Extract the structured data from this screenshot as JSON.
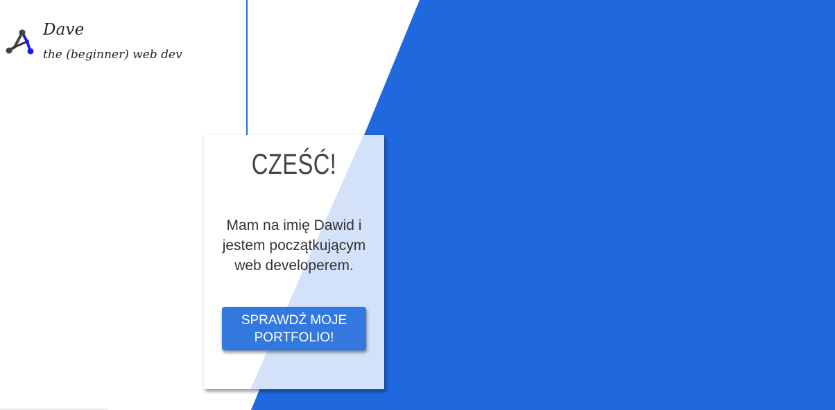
{
  "brand": {
    "name": "Dave",
    "tagline": "the (beginner) web dev",
    "logo_icon": "molecule-network-icon"
  },
  "hero": {
    "title": "CZEŚĆ!",
    "intro": "Mam na imię Dawid i jestem początkującym web developerem.",
    "cta_label": "SPRAWDŹ MOJE PORTFOLIO!"
  },
  "colors": {
    "accent_blue": "#1f68dd",
    "card_overlay": "#d3e2f8",
    "button_blue": "#3378df",
    "text_dark": "#333333"
  }
}
